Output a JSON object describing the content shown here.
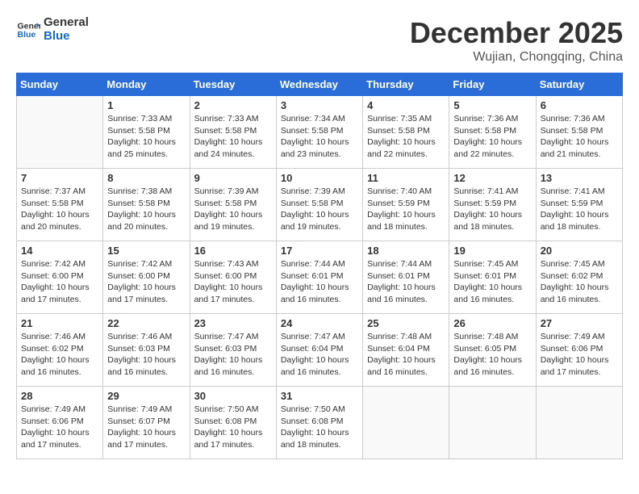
{
  "logo": {
    "line1": "General",
    "line2": "Blue"
  },
  "title": "December 2025",
  "subtitle": "Wujian, Chongqing, China",
  "weekdays": [
    "Sunday",
    "Monday",
    "Tuesday",
    "Wednesday",
    "Thursday",
    "Friday",
    "Saturday"
  ],
  "weeks": [
    [
      {
        "day": "",
        "info": ""
      },
      {
        "day": "1",
        "info": "Sunrise: 7:33 AM\nSunset: 5:58 PM\nDaylight: 10 hours\nand 25 minutes."
      },
      {
        "day": "2",
        "info": "Sunrise: 7:33 AM\nSunset: 5:58 PM\nDaylight: 10 hours\nand 24 minutes."
      },
      {
        "day": "3",
        "info": "Sunrise: 7:34 AM\nSunset: 5:58 PM\nDaylight: 10 hours\nand 23 minutes."
      },
      {
        "day": "4",
        "info": "Sunrise: 7:35 AM\nSunset: 5:58 PM\nDaylight: 10 hours\nand 22 minutes."
      },
      {
        "day": "5",
        "info": "Sunrise: 7:36 AM\nSunset: 5:58 PM\nDaylight: 10 hours\nand 22 minutes."
      },
      {
        "day": "6",
        "info": "Sunrise: 7:36 AM\nSunset: 5:58 PM\nDaylight: 10 hours\nand 21 minutes."
      }
    ],
    [
      {
        "day": "7",
        "info": "Sunrise: 7:37 AM\nSunset: 5:58 PM\nDaylight: 10 hours\nand 20 minutes."
      },
      {
        "day": "8",
        "info": "Sunrise: 7:38 AM\nSunset: 5:58 PM\nDaylight: 10 hours\nand 20 minutes."
      },
      {
        "day": "9",
        "info": "Sunrise: 7:39 AM\nSunset: 5:58 PM\nDaylight: 10 hours\nand 19 minutes."
      },
      {
        "day": "10",
        "info": "Sunrise: 7:39 AM\nSunset: 5:58 PM\nDaylight: 10 hours\nand 19 minutes."
      },
      {
        "day": "11",
        "info": "Sunrise: 7:40 AM\nSunset: 5:59 PM\nDaylight: 10 hours\nand 18 minutes."
      },
      {
        "day": "12",
        "info": "Sunrise: 7:41 AM\nSunset: 5:59 PM\nDaylight: 10 hours\nand 18 minutes."
      },
      {
        "day": "13",
        "info": "Sunrise: 7:41 AM\nSunset: 5:59 PM\nDaylight: 10 hours\nand 18 minutes."
      }
    ],
    [
      {
        "day": "14",
        "info": "Sunrise: 7:42 AM\nSunset: 6:00 PM\nDaylight: 10 hours\nand 17 minutes."
      },
      {
        "day": "15",
        "info": "Sunrise: 7:42 AM\nSunset: 6:00 PM\nDaylight: 10 hours\nand 17 minutes."
      },
      {
        "day": "16",
        "info": "Sunrise: 7:43 AM\nSunset: 6:00 PM\nDaylight: 10 hours\nand 17 minutes."
      },
      {
        "day": "17",
        "info": "Sunrise: 7:44 AM\nSunset: 6:01 PM\nDaylight: 10 hours\nand 16 minutes."
      },
      {
        "day": "18",
        "info": "Sunrise: 7:44 AM\nSunset: 6:01 PM\nDaylight: 10 hours\nand 16 minutes."
      },
      {
        "day": "19",
        "info": "Sunrise: 7:45 AM\nSunset: 6:01 PM\nDaylight: 10 hours\nand 16 minutes."
      },
      {
        "day": "20",
        "info": "Sunrise: 7:45 AM\nSunset: 6:02 PM\nDaylight: 10 hours\nand 16 minutes."
      }
    ],
    [
      {
        "day": "21",
        "info": "Sunrise: 7:46 AM\nSunset: 6:02 PM\nDaylight: 10 hours\nand 16 minutes."
      },
      {
        "day": "22",
        "info": "Sunrise: 7:46 AM\nSunset: 6:03 PM\nDaylight: 10 hours\nand 16 minutes."
      },
      {
        "day": "23",
        "info": "Sunrise: 7:47 AM\nSunset: 6:03 PM\nDaylight: 10 hours\nand 16 minutes."
      },
      {
        "day": "24",
        "info": "Sunrise: 7:47 AM\nSunset: 6:04 PM\nDaylight: 10 hours\nand 16 minutes."
      },
      {
        "day": "25",
        "info": "Sunrise: 7:48 AM\nSunset: 6:04 PM\nDaylight: 10 hours\nand 16 minutes."
      },
      {
        "day": "26",
        "info": "Sunrise: 7:48 AM\nSunset: 6:05 PM\nDaylight: 10 hours\nand 16 minutes."
      },
      {
        "day": "27",
        "info": "Sunrise: 7:49 AM\nSunset: 6:06 PM\nDaylight: 10 hours\nand 17 minutes."
      }
    ],
    [
      {
        "day": "28",
        "info": "Sunrise: 7:49 AM\nSunset: 6:06 PM\nDaylight: 10 hours\nand 17 minutes."
      },
      {
        "day": "29",
        "info": "Sunrise: 7:49 AM\nSunset: 6:07 PM\nDaylight: 10 hours\nand 17 minutes."
      },
      {
        "day": "30",
        "info": "Sunrise: 7:50 AM\nSunset: 6:08 PM\nDaylight: 10 hours\nand 17 minutes."
      },
      {
        "day": "31",
        "info": "Sunrise: 7:50 AM\nSunset: 6:08 PM\nDaylight: 10 hours\nand 18 minutes."
      },
      {
        "day": "",
        "info": ""
      },
      {
        "day": "",
        "info": ""
      },
      {
        "day": "",
        "info": ""
      }
    ]
  ]
}
